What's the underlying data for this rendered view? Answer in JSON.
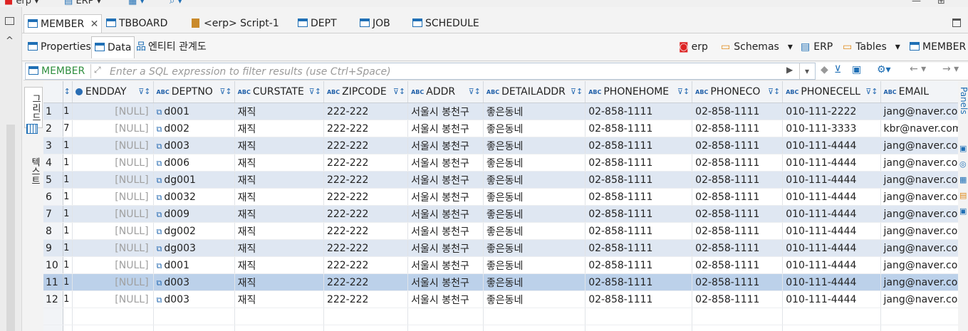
{
  "top_toolbar": {
    "connection": "erp",
    "project": "ERP"
  },
  "editor_tabs": [
    {
      "label": "MEMBER",
      "active": true,
      "closable": true
    },
    {
      "label": "TBBOARD"
    },
    {
      "label": "<erp> Script-1"
    },
    {
      "label": "DEPT"
    },
    {
      "label": "JOB"
    },
    {
      "label": "SCHEDULE"
    }
  ],
  "sub_tabs": [
    {
      "label": "Properties"
    },
    {
      "label": "Data",
      "active": true
    },
    {
      "label": "엔티티 관계도"
    }
  ],
  "breadcrumb": {
    "connection": "erp",
    "schemas": "Schemas",
    "db": "ERP",
    "tables": "Tables",
    "table": "MEMBER"
  },
  "filter": {
    "table_label": "MEMBER",
    "placeholder": "Enter a SQL expression to filter results (use Ctrl+Space)"
  },
  "view_tabs": {
    "grid": "그리드",
    "text": "텍스트"
  },
  "right_panel_label": "Panels",
  "columns": [
    "ENDDAY",
    "DEPTNO",
    "CURSTATE",
    "ZIPCODE",
    "ADDR",
    "DETAILADDR",
    "PHONEHOME",
    "PHONECO",
    "PHONECELL",
    "EMAIL"
  ],
  "rows": [
    {
      "n": "1",
      "prev": "1",
      "endday": "[NULL]",
      "deptno": "d001",
      "curstate": "재직",
      "zipcode": "222-222",
      "addr": "서울시 봉천구",
      "detailaddr": "좋은동네",
      "phonehome": "02-858-1111",
      "phoneco": "02-858-1111",
      "phonecell": "010-111-2222",
      "email": "jang@naver.com"
    },
    {
      "n": "2",
      "prev": "7",
      "endday": "[NULL]",
      "deptno": "d002",
      "curstate": "재직",
      "zipcode": "222-222",
      "addr": "서울시 봉천구",
      "detailaddr": "좋은동네",
      "phonehome": "02-858-1111",
      "phoneco": "02-858-1111",
      "phonecell": "010-111-3333",
      "email": "kbr@naver.com"
    },
    {
      "n": "3",
      "prev": "1",
      "endday": "[NULL]",
      "deptno": "d003",
      "curstate": "재직",
      "zipcode": "222-222",
      "addr": "서울시 봉천구",
      "detailaddr": "좋은동네",
      "phonehome": "02-858-1111",
      "phoneco": "02-858-1111",
      "phonecell": "010-111-4444",
      "email": "jang@naver.com"
    },
    {
      "n": "4",
      "prev": "1",
      "endday": "[NULL]",
      "deptno": "d006",
      "curstate": "재직",
      "zipcode": "222-222",
      "addr": "서울시 봉천구",
      "detailaddr": "좋은동네",
      "phonehome": "02-858-1111",
      "phoneco": "02-858-1111",
      "phonecell": "010-111-4444",
      "email": "jang@naver.com"
    },
    {
      "n": "5",
      "prev": "1",
      "endday": "[NULL]",
      "deptno": "dg001",
      "curstate": "재직",
      "zipcode": "222-222",
      "addr": "서울시 봉천구",
      "detailaddr": "좋은동네",
      "phonehome": "02-858-1111",
      "phoneco": "02-858-1111",
      "phonecell": "010-111-4444",
      "email": "jang@naver.com"
    },
    {
      "n": "6",
      "prev": "1",
      "endday": "[NULL]",
      "deptno": "d0032",
      "curstate": "재직",
      "zipcode": "222-222",
      "addr": "서울시 봉천구",
      "detailaddr": "좋은동네",
      "phonehome": "02-858-1111",
      "phoneco": "02-858-1111",
      "phonecell": "010-111-4444",
      "email": "jang@naver.com"
    },
    {
      "n": "7",
      "prev": "1",
      "endday": "[NULL]",
      "deptno": "d009",
      "curstate": "재직",
      "zipcode": "222-222",
      "addr": "서울시 봉천구",
      "detailaddr": "좋은동네",
      "phonehome": "02-858-1111",
      "phoneco": "02-858-1111",
      "phonecell": "010-111-4444",
      "email": "jang@naver.com"
    },
    {
      "n": "8",
      "prev": "1",
      "endday": "[NULL]",
      "deptno": "dg002",
      "curstate": "재직",
      "zipcode": "222-222",
      "addr": "서울시 봉천구",
      "detailaddr": "좋은동네",
      "phonehome": "02-858-1111",
      "phoneco": "02-858-1111",
      "phonecell": "010-111-4444",
      "email": "jang@naver.com"
    },
    {
      "n": "9",
      "prev": "1",
      "endday": "[NULL]",
      "deptno": "dg003",
      "curstate": "재직",
      "zipcode": "222-222",
      "addr": "서울시 봉천구",
      "detailaddr": "좋은동네",
      "phonehome": "02-858-1111",
      "phoneco": "02-858-1111",
      "phonecell": "010-111-4444",
      "email": "jang@naver.com"
    },
    {
      "n": "10",
      "prev": "1",
      "endday": "[NULL]",
      "deptno": "d001",
      "curstate": "재직",
      "zipcode": "222-222",
      "addr": "서울시 봉천구",
      "detailaddr": "좋은동네",
      "phonehome": "02-858-1111",
      "phoneco": "02-858-1111",
      "phonecell": "010-111-4444",
      "email": "jang@naver.com"
    },
    {
      "n": "11",
      "prev": "1",
      "endday": "[NULL]",
      "deptno": "d003",
      "curstate": "재직",
      "zipcode": "222-222",
      "addr": "서울시 봉천구",
      "detailaddr": "좋은동네",
      "phonehome": "02-858-1111",
      "phoneco": "02-858-1111",
      "phonecell": "010-111-4444",
      "email": "jang@naver.com"
    },
    {
      "n": "12",
      "prev": "1",
      "endday": "[NULL]",
      "deptno": "d003",
      "curstate": "재직",
      "zipcode": "222-222",
      "addr": "서울시 봉천구",
      "detailaddr": "좋은동네",
      "phonehome": "02-858-1111",
      "phoneco": "02-858-1111",
      "phonecell": "010-111-4444",
      "email": "jang@naver.com"
    }
  ],
  "colors": {
    "accent": "#1f6fb5",
    "row_alt": "#dfe7f2",
    "row_selected": "#bcd1ea",
    "null_text": "#a0a0a0"
  }
}
